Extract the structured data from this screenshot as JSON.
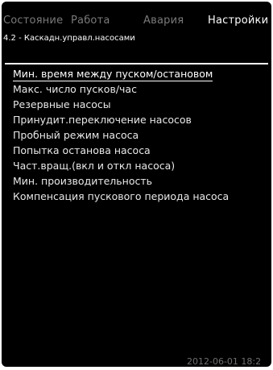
{
  "tabs": [
    {
      "label": "Состояние",
      "active": false
    },
    {
      "label": "Работа",
      "active": false
    },
    {
      "label": "Авария",
      "active": false
    },
    {
      "label": "Настройки",
      "active": true
    }
  ],
  "subtitle": "4.2 - Каскадн.управл.насосами",
  "menu": {
    "items": [
      {
        "label": "Мин. время между пуском/остановом",
        "selected": true
      },
      {
        "label": "Макс. число пусков/час",
        "selected": false
      },
      {
        "label": "Резервные насосы",
        "selected": false
      },
      {
        "label": "Принудит.переключение насосов",
        "selected": false
      },
      {
        "label": "Пробный режим насоса",
        "selected": false
      },
      {
        "label": "Попытка останова насоса",
        "selected": false
      },
      {
        "label": "Част.вращ.(вкл и откл насоса)",
        "selected": false
      },
      {
        "label": "Мин. производительность",
        "selected": false
      },
      {
        "label": "Компенсация пускового периода насоса",
        "selected": false
      }
    ]
  },
  "footer": {
    "datetime": "2012-06-01 18:2"
  },
  "colors": {
    "background": "#000000",
    "text": "#ffffff",
    "inactive_tab": "#7a7a7a",
    "footer_text": "#6f6f6f"
  }
}
